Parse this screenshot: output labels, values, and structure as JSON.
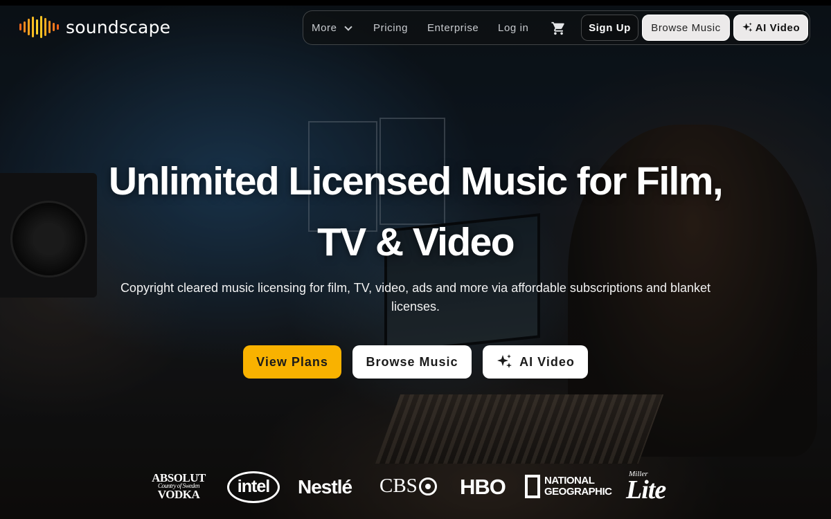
{
  "brand": {
    "name": "soundscape",
    "wave_colors": [
      "#f46a1c",
      "#f58a1d",
      "#f7a21f",
      "#f9bb22",
      "#fbd12a",
      "#f9c524",
      "#f7ad1f",
      "#f69520",
      "#f57b1e",
      "#f4641b"
    ]
  },
  "nav": {
    "more_label": "More",
    "pricing_label": "Pricing",
    "enterprise_label": "Enterprise",
    "login_label": "Log in",
    "signup_label": "Sign Up",
    "browse_label": "Browse Music",
    "ai_video_label": "AI Video"
  },
  "hero": {
    "headline": "Unlimited Licensed Music for Film, TV & Video",
    "subheadline": "Copyright cleared music licensing for film, TV, video, ads and more via affordable subscriptions and blanket licenses.",
    "cta_plans": "View Plans",
    "cta_browse": "Browse Music",
    "cta_ai_video": "AI Video"
  },
  "clients": {
    "absolut_main_1": "ABSOLUT",
    "absolut_sub": "Country of Sweden",
    "absolut_main_2": "VODKA",
    "intel": "intel",
    "nestle": "Nestlé",
    "cbs": "CBS",
    "hbo": "HBO",
    "natgeo_line1": "NATIONAL",
    "natgeo_line2": "GEOGRAPHIC",
    "miller": "Miller",
    "lite": "Lite"
  },
  "colors": {
    "accent": "#f9b200",
    "nav_bg": "#0e1012",
    "button_light": "#eceaea"
  },
  "icons": {
    "cart": "cart-icon",
    "sparkle": "sparkle-icon",
    "chevron": "chevron-down-icon"
  }
}
